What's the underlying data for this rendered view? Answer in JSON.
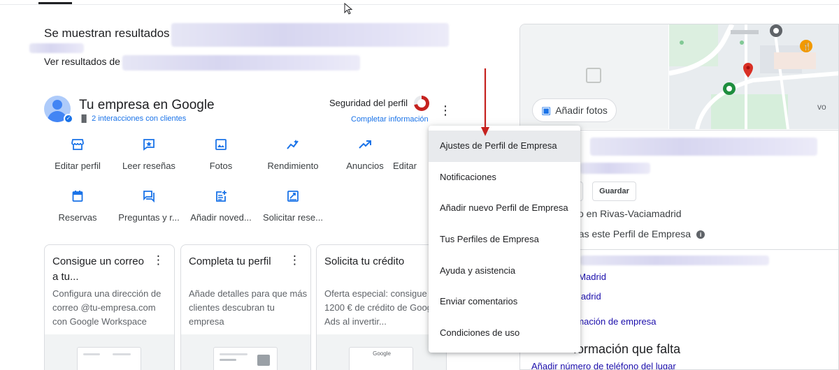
{
  "results": {
    "showing_text": "Se muestran resultados",
    "see_results_text": "Ver resultados de"
  },
  "business": {
    "title": "Tu empresa en Google",
    "interactions": "2 interacciones con clientes",
    "security_label": "Seguridad del perfil",
    "complete_info": "Completar información",
    "security_fraction": 0.72
  },
  "actions": [
    {
      "label": "Editar perfil",
      "icon": "storefront-icon"
    },
    {
      "label": "Leer reseñas",
      "icon": "star-review-icon"
    },
    {
      "label": "Fotos",
      "icon": "photo-icon"
    },
    {
      "label": "Rendimiento",
      "icon": "performance-icon"
    },
    {
      "label": "Anuncios",
      "icon": "trending-up-icon"
    },
    {
      "label": "Editar",
      "icon": "edit-icon"
    },
    {
      "label": "Reservas",
      "icon": "calendar-icon"
    },
    {
      "label": "Preguntas y r...",
      "icon": "qa-icon"
    },
    {
      "label": "Añadir noved...",
      "icon": "post-add-icon"
    },
    {
      "label": "Solicitar rese...",
      "icon": "request-review-icon"
    }
  ],
  "cards": [
    {
      "title": "Consigue un correo a tu...",
      "desc": "Configura una dirección de correo @tu-empresa.com con Google Workspace"
    },
    {
      "title": "Completa tu perfil",
      "desc": "Añade detalles para que más clientes descubran tu empresa"
    },
    {
      "title": "Solicita tu crédito",
      "desc": "Oferta especial: consigue 1200 € de crédito de Google Ads al invertir..."
    }
  ],
  "card_image_label": "Google",
  "right_panel": {
    "add_photos": "Añadir fotos",
    "save": "Guardar",
    "location_line": "vo en Rivas-Vaciamadrid",
    "manage_line": "nas este Perfil de Empresa",
    "link1": ", Madrid",
    "link2": "Madrid",
    "link3": "rmación de empresa",
    "missing_heading": "formación que falta",
    "add_phone": "Añadir número de teléfono del lugar",
    "map_label": "vo"
  },
  "menu": {
    "items": [
      "Ajustes de Perfil de Empresa",
      "Notificaciones",
      "Añadir nuevo Perfil de Empresa",
      "Tus Perfiles de Empresa",
      "Ayuda y asistencia",
      "Enviar comentarios",
      "Condiciones de uso"
    ],
    "highlighted_index": 0
  },
  "colors": {
    "accent": "#1a73e8",
    "annotation_arrow": "#c5221f",
    "security_ring": "#c5221f"
  }
}
